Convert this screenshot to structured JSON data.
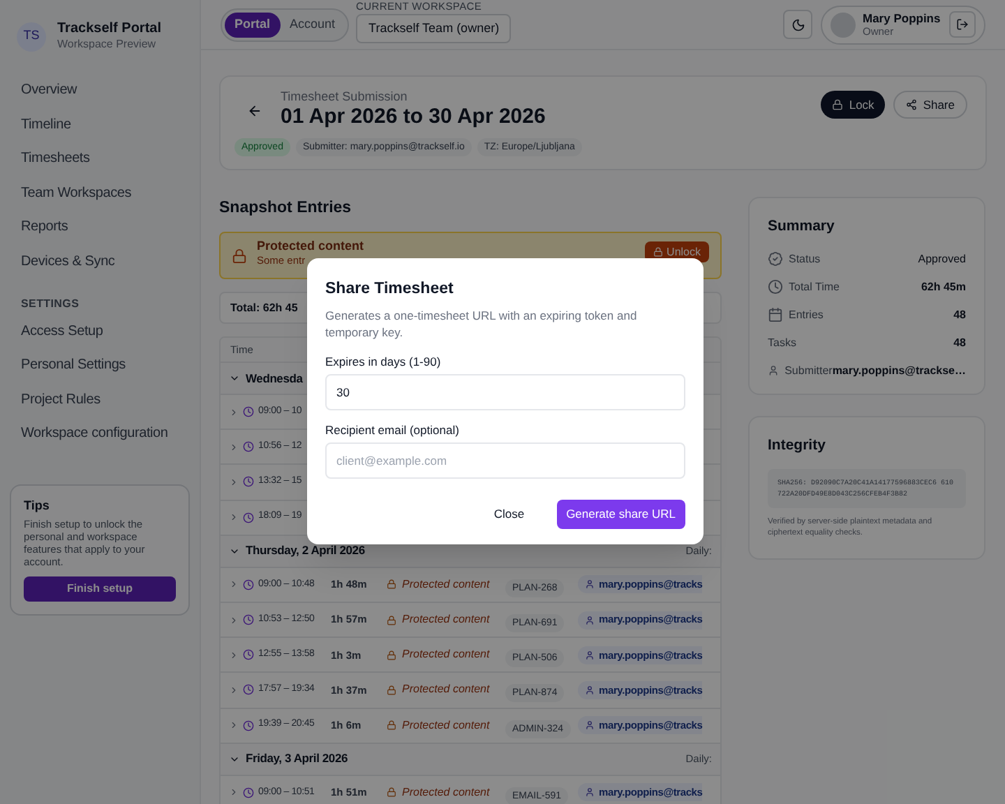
{
  "sidebar": {
    "brand": {
      "initials": "TS",
      "title": "Trackself Portal",
      "subtitle": "Workspace Preview"
    },
    "nav": [
      {
        "label": "Overview",
        "selected": false
      },
      {
        "label": "Timeline",
        "selected": false
      },
      {
        "label": "Timesheets",
        "selected": false
      },
      {
        "label": "Team Workspaces",
        "selected": false
      },
      {
        "label": "Reports",
        "selected": false
      },
      {
        "label": "Devices & Sync",
        "selected": false
      }
    ],
    "settings_heading": "SETTINGS",
    "settings": [
      {
        "label": "Access Setup",
        "selected": false
      },
      {
        "label": "Personal Settings",
        "selected": false
      },
      {
        "label": "Project Rules",
        "selected": false
      },
      {
        "label": "Workspace configuration",
        "selected": false
      }
    ],
    "tips": {
      "title": "Tips",
      "text": "Finish setup to unlock the personal and workspace features that apply to your account.",
      "button": "Finish setup"
    }
  },
  "header": {
    "mode_toggle": [
      {
        "label": "Portal",
        "selected": true
      },
      {
        "label": "Account",
        "selected": false
      }
    ],
    "workspace": {
      "label": "CURRENT WORKSPACE",
      "value": "Trackself Team (owner)"
    },
    "user": {
      "name": "Mary Poppins",
      "role": "Owner"
    }
  },
  "submission": {
    "eyebrow": "Timesheet Submission",
    "title": "01 Apr 2026 to 30 Apr 2026",
    "badges": [
      {
        "label": "Approved",
        "kind": "status"
      },
      {
        "label": "Submitter: mary.poppins@trackself.io",
        "kind": "info"
      },
      {
        "label": "TZ: Europe/Ljubljana",
        "kind": "info"
      }
    ],
    "actions": [
      {
        "label": "Lock",
        "kind": "primary"
      },
      {
        "label": "Share",
        "kind": "secondary"
      }
    ]
  },
  "snapshot": {
    "title": "Snapshot Entries",
    "banner": {
      "title": "Protected content",
      "text": "Some entr",
      "button": "Unlock"
    },
    "total": "Total: 62h 45",
    "table": {
      "column_1": "Time",
      "groups": [
        {
          "label": "Wednesda",
          "rows": [
            {
              "time": "09:00 – 10"
            },
            {
              "time": "10:56 – 12"
            },
            {
              "time": "13:32 – 15"
            },
            {
              "time": "18:09 – 19"
            }
          ]
        },
        {
          "label": "Thursday, 2 April 2026",
          "daily": "Daily:",
          "rows": [
            {
              "time": "09:00 – 10:48",
              "duration": "1h 48m",
              "content": "Protected content",
              "ticket": "PLAN-268",
              "user": "mary.poppins@tracks"
            },
            {
              "time": "10:53 – 12:50",
              "duration": "1h 57m",
              "content": "Protected content",
              "ticket": "PLAN-691",
              "user": "mary.poppins@tracks"
            },
            {
              "time": "12:55 – 13:58",
              "duration": "1h 3m",
              "content": "Protected content",
              "ticket": "PLAN-506",
              "user": "mary.poppins@tracks"
            },
            {
              "time": "17:57 – 19:34",
              "duration": "1h 37m",
              "content": "Protected content",
              "ticket": "PLAN-874",
              "user": "mary.poppins@tracks"
            },
            {
              "time": "19:39 – 20:45",
              "duration": "1h 6m",
              "content": "Protected content",
              "ticket": "ADMIN-324",
              "user": "mary.poppins@tracks"
            }
          ]
        },
        {
          "label": "Friday, 3 April 2026",
          "daily": "Daily:",
          "rows": [
            {
              "time": "09:00 – 10:51",
              "duration": "1h 51m",
              "content": "Protected content",
              "ticket": "EMAIL-591",
              "user": "mary.poppins@tracks"
            }
          ]
        }
      ]
    }
  },
  "summary": {
    "title": "Summary",
    "rows": [
      {
        "kind": "status",
        "label": "Status",
        "value": "Approved"
      },
      {
        "kind": "time",
        "label": "Total Time",
        "value": "62h 45m"
      },
      {
        "kind": "entries",
        "label": "Entries",
        "value": "48"
      },
      {
        "kind": "tasks",
        "label": "Tasks",
        "value": "48"
      },
      {
        "kind": "submitter",
        "label": "Submitter",
        "value": "mary.poppins@trackse…"
      }
    ]
  },
  "integrity": {
    "title": "Integrity",
    "hash": "SHA256: D92090C7A20C41A14177596883CEC6 610722A20DFD49E8D043C256CFEB4F3B82",
    "note": "Verified by server-side plaintext metadata and ciphertext equality checks."
  },
  "modal": {
    "title": "Share Timesheet",
    "description": "Generates a one-timesheet URL with an expiring token and temporary key.",
    "fields": [
      {
        "label": "Expires in days (1-90)",
        "value": "30"
      },
      {
        "label": "Recipient email (optional)",
        "placeholder": "client@example.com"
      }
    ],
    "buttons": [
      {
        "label": "Close",
        "kind": "secondary"
      },
      {
        "label": "Generate share URL",
        "kind": "primary"
      }
    ]
  }
}
